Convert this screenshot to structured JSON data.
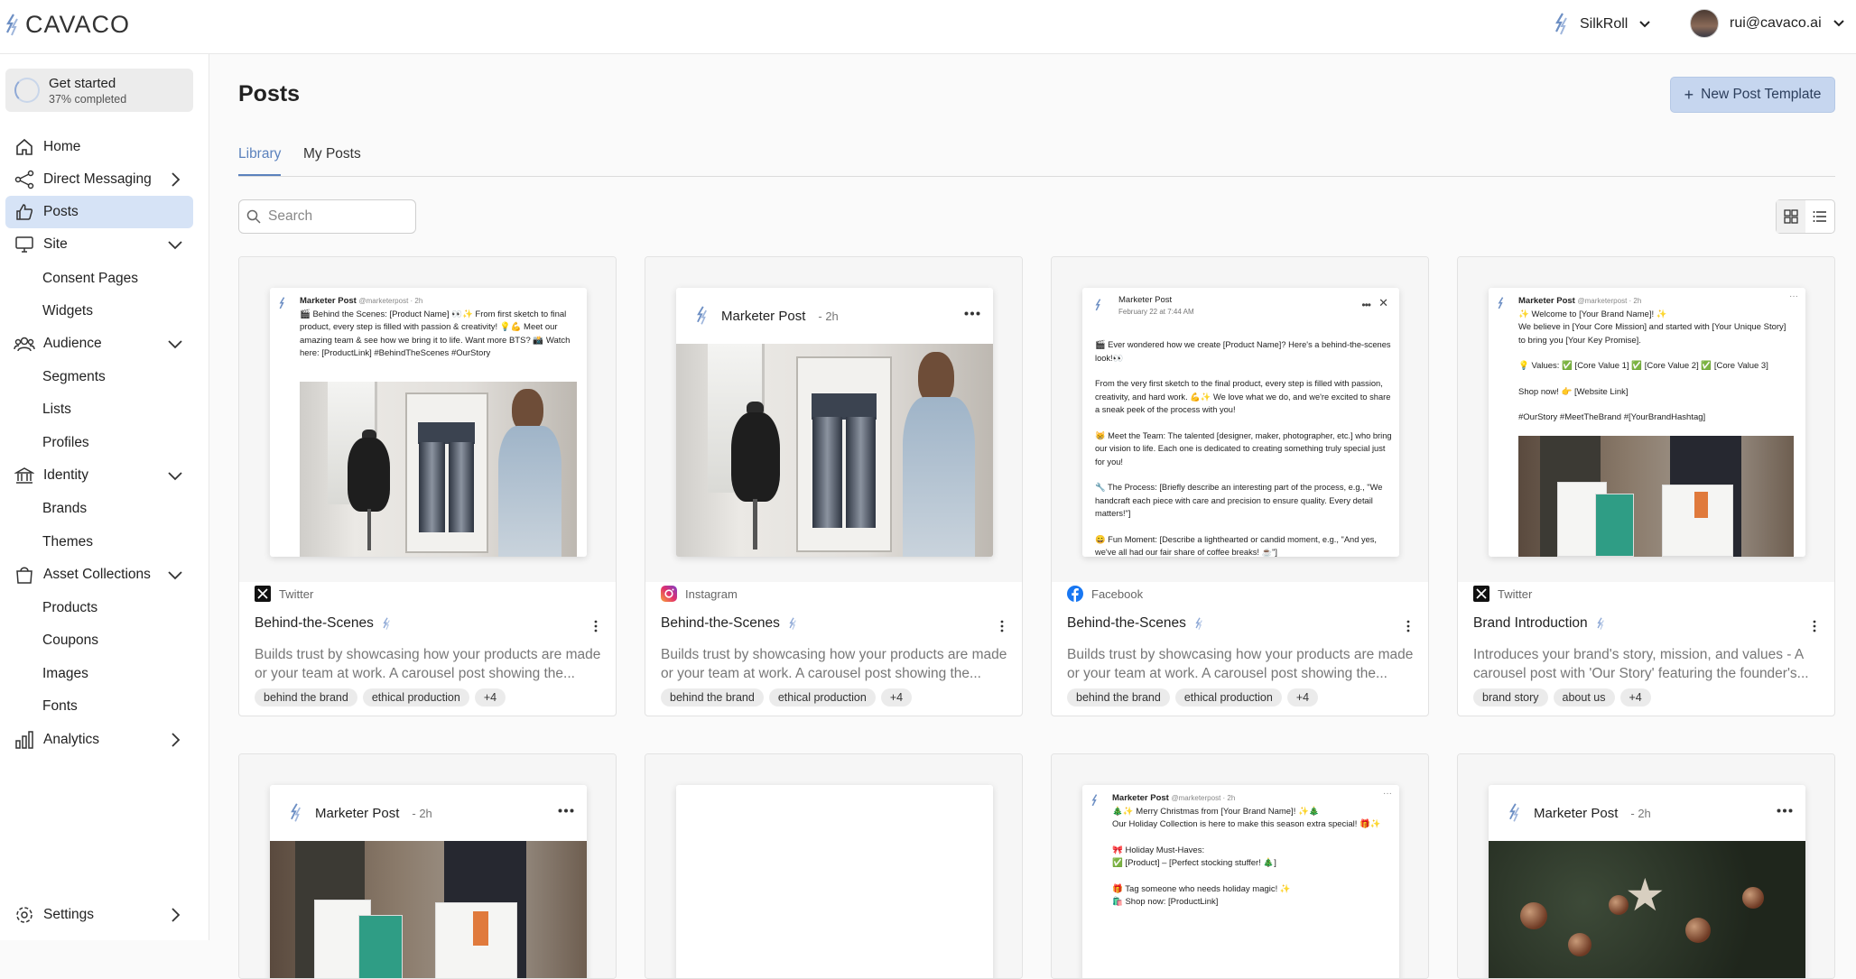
{
  "app": {
    "logo_text": "CAVACO",
    "brand_selector": "SilkRoll",
    "user_email": "rui@cavaco.ai"
  },
  "sidebar": {
    "get_started": {
      "title": "Get started",
      "subtitle": "37% completed",
      "progress_percent": 37
    },
    "items": [
      {
        "label": "Home",
        "icon": "home-icon"
      },
      {
        "label": "Direct Messaging",
        "icon": "share-icon"
      },
      {
        "label": "Posts",
        "icon": "thumbs-up-icon"
      },
      {
        "label": "Site",
        "icon": "monitor-icon"
      },
      {
        "label": "Consent Pages"
      },
      {
        "label": "Widgets"
      },
      {
        "label": "Audience",
        "icon": "users-icon"
      },
      {
        "label": "Segments"
      },
      {
        "label": "Lists"
      },
      {
        "label": "Profiles"
      },
      {
        "label": "Identity",
        "icon": "bank-icon"
      },
      {
        "label": "Brands"
      },
      {
        "label": "Themes"
      },
      {
        "label": "Asset Collections",
        "icon": "bag-icon"
      },
      {
        "label": "Products"
      },
      {
        "label": "Coupons"
      },
      {
        "label": "Images"
      },
      {
        "label": "Fonts"
      },
      {
        "label": "Analytics",
        "icon": "bar-chart-icon"
      },
      {
        "label": "Settings",
        "icon": "gear-icon"
      }
    ]
  },
  "main": {
    "title": "Posts",
    "new_button": "New Post Template",
    "tabs": [
      "Library",
      "My Posts"
    ],
    "search_placeholder": "Search"
  },
  "preview_text": {
    "twitter_author": "Marketer Post",
    "twitter_handle": "@marketerpost · 2h",
    "mp_author": "Marketer Post",
    "mp_time": "- 2h",
    "fb_author": "Marketer Post",
    "fb_date": "February 22 at 7:44 AM",
    "tw1_body": "🎬 Behind the Scenes: [Product Name] 👀✨ From first sketch to final product, every step is filled with passion & creativity! 💡💪 Meet our amazing team & see how we bring it to life. Want more BTS? 📸 Watch here: [ProductLink] #BehindTheScenes #OurStory",
    "fb_p1": "🎬 Ever wondered how we create [Product Name]? Here's a behind-the-scenes look!👀",
    "fb_p2": "From the very first sketch to the final product, every step is filled with passion, creativity, and hard work. 💪✨ We love what we do, and we're excited to share a sneak peek of the process with you!",
    "fb_p3": "😸 Meet the Team: The talented [designer, maker, photographer, etc.] who bring our vision to life. Each one is dedicated to creating something truly special just for you!",
    "fb_p4": "🔧 The Process: [Briefly describe an interesting part of the process, e.g., \"We handcraft each piece with care and precision to ensure quality. Every detail matters!\"]",
    "fb_p5": "😄 Fun Moment: [Describe a lighthearted or candid moment, e.g., \"And yes, we've all had our fair share of coffee breaks! ☕\"]",
    "tw4_p1": "✨ Welcome to [Your Brand Name]! ✨",
    "tw4_p2": "We believe in [Your Core Mission] and started with [Your Unique Story] to bring you [Your Key Promise].",
    "tw4_p3": "💡 Values: ✅ [Core Value 1] ✅ [Core Value 2] ✅ [Core Value 3]",
    "tw4_p4": "Shop now! 👉 [Website Link]",
    "tw4_p5": "#OurStory #MeetTheBrand #[YourBrandHashtag]",
    "xmas_p1": "🎄✨ Merry Christmas from [Your Brand Name]! ✨🎄",
    "xmas_p2": "Our Holiday Collection is here to make this season extra special! 🎁✨",
    "xmas_p3": "🎀 Holiday Must-Haves:",
    "xmas_p4": "✅ [Product] – [Perfect stocking stuffer! 🎄]",
    "xmas_p5": "🎁 Tag someone who needs holiday magic! ✨",
    "xmas_p6": "🛍️ Shop now: [ProductLink]"
  },
  "cards": [
    {
      "platform": "Twitter",
      "title": "Behind-the-Scenes",
      "description": "Builds trust by showcasing how your products are made or your team at work. A carousel post showing the...",
      "tags": [
        "behind the brand",
        "ethical production",
        "+4"
      ]
    },
    {
      "platform": "Instagram",
      "title": "Behind-the-Scenes",
      "description": "Builds trust by showcasing how your products are made or your team at work. A carousel post showing the...",
      "tags": [
        "behind the brand",
        "ethical production",
        "+4"
      ]
    },
    {
      "platform": "Facebook",
      "title": "Behind-the-Scenes",
      "description": "Builds trust by showcasing how your products are made or your team at work. A carousel post showing the...",
      "tags": [
        "behind the brand",
        "ethical production",
        "+4"
      ]
    },
    {
      "platform": "Twitter",
      "title": "Brand Introduction",
      "description": "Introduces your brand's story, mission, and values - A carousel post with 'Our Story' featuring the founder's...",
      "tags": [
        "brand story",
        "about us",
        "+4"
      ]
    }
  ],
  "colors": {
    "accent": "#5b82bd",
    "active_nav": "#d6e3f6",
    "button_bg": "#c6d6ef"
  }
}
